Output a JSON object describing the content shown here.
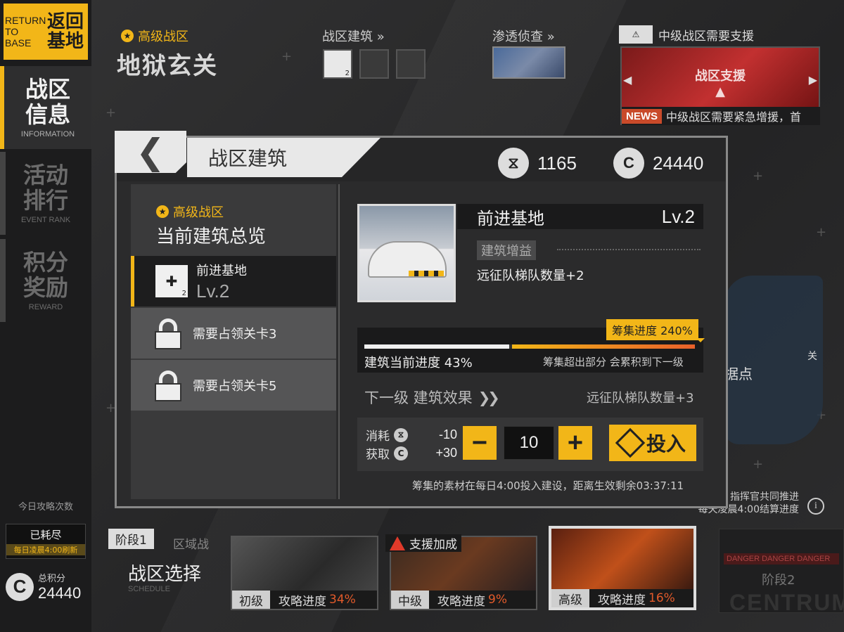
{
  "sidebar": {
    "return_en": "RETURN TO BASE",
    "return_cn": "返回基地",
    "items": [
      {
        "cn": "战区信息",
        "en": "INFORMATION"
      },
      {
        "cn": "活动排行",
        "en": "EVENT RANK"
      },
      {
        "cn": "积分奖励",
        "en": "REWARD"
      }
    ],
    "daily_title": "今日攻略次数",
    "daily_status": "已耗尽",
    "daily_refresh": "每日凌晨4:00刷新",
    "total_label": "总积分",
    "total_value": "24440",
    "coin_glyph": "C"
  },
  "header": {
    "zone_tag": "高级战区",
    "zone_name": "地狱玄关",
    "buildings_label": "战区建筑",
    "infiltration_label": "渗透侦查",
    "support_title": "中级战区需要支援",
    "support_banner": "战区支援",
    "news_tag": "NEWS",
    "news_text": "中级战区需要紧急增援，首",
    "slot_badge": "2"
  },
  "map": {
    "stronghold": "据点",
    "side_label": "关",
    "coop_line1": "指挥官共同推进",
    "coop_line2": "每天凌晨4:00结算进度",
    "info_glyph": "i"
  },
  "stage": {
    "tag": "阶段1",
    "sub": "区域战",
    "title": "战区选择",
    "title_en": "SCHEDULE",
    "boost": "支援加成",
    "progress_label": "攻略进度",
    "cards": [
      {
        "level": "初级",
        "pct": "34%"
      },
      {
        "level": "中级",
        "pct": "9%"
      },
      {
        "level": "高级",
        "pct": "16%"
      }
    ],
    "stage2_danger": "DANGER DANGER DANGER",
    "stage2_name": "阶段2",
    "stage2_centrum": "CENTRUM"
  },
  "modal": {
    "back_glyph": "❮",
    "title": "战区建筑",
    "res1_value": "1165",
    "res2_value": "24440",
    "res2_glyph": "C",
    "left": {
      "tag": "高级战区",
      "title": "当前建筑总览",
      "items": [
        {
          "name": "前进基地",
          "level": "Lv.2",
          "badge": "2"
        },
        {
          "name": "需要占领关卡3"
        },
        {
          "name": "需要占领关卡5"
        }
      ]
    },
    "building": {
      "name": "前进基地",
      "level": "Lv.2",
      "buff_tag": "建筑增益",
      "buff_text": "远征队梯队数量+2",
      "raise_chip": "筹集进度 240%",
      "build_progress": "建筑当前进度 43%",
      "build_fraction": 0.43,
      "overflow_note": "筹集超出部分 会累积到下一级",
      "next_level_label": "下一级 建筑效果",
      "next_level_chevron": "❯❯",
      "next_effect": "远征队梯队数量+3",
      "consume_label": "消耗",
      "consume_value": "-10",
      "gain_label": "获取",
      "gain_value": "+30",
      "minus_glyph": "−",
      "plus_glyph": "+",
      "quantity": "10",
      "invest_label": "投入",
      "footer_note": "筹集的素材在每日4:00投入建设，距离生效剩余03:37:11"
    }
  },
  "colors": {
    "accent": "#f2b618",
    "danger": "#e25a2a",
    "panel": "#2b2b2c"
  }
}
